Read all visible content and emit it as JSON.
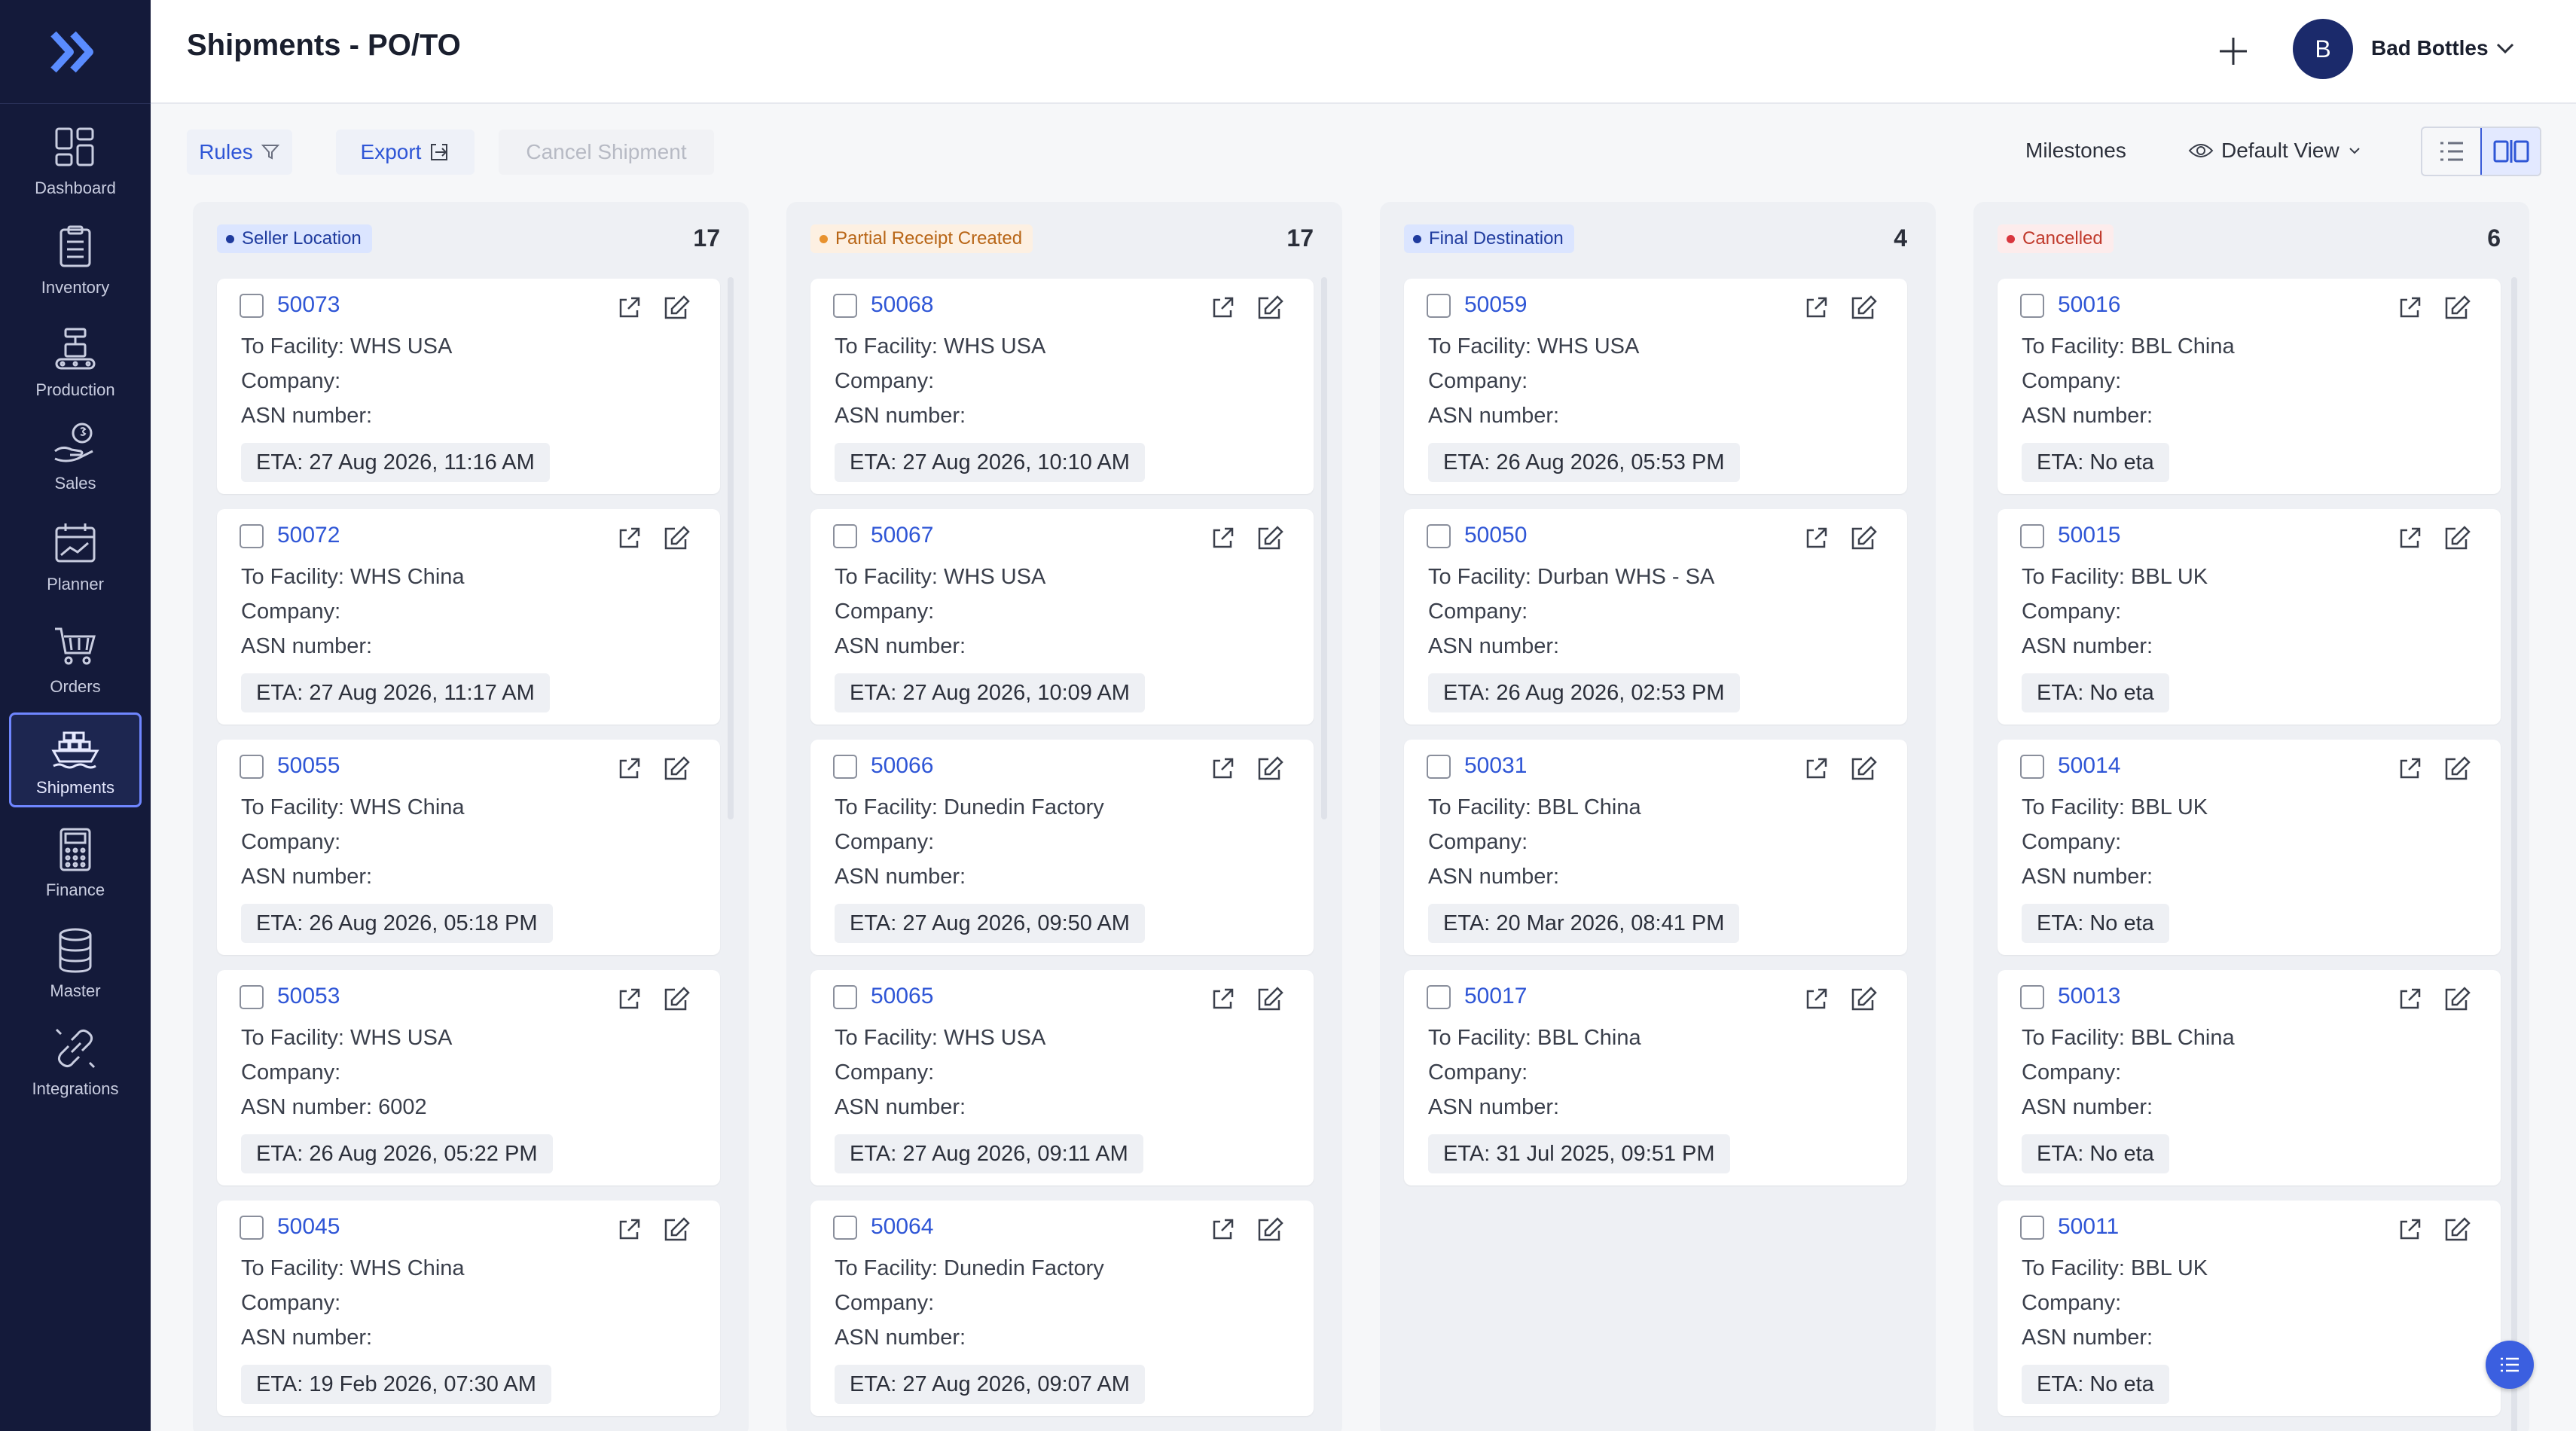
{
  "app": {
    "title": "Shipments - PO/TO",
    "company": "Bad Bottles",
    "avatar_letter": "B",
    "accent": "#2f56d6",
    "sidebar_bg": "#141a3a"
  },
  "sidebar": {
    "items": [
      {
        "label": "Dashboard",
        "icon": "dashboard-icon"
      },
      {
        "label": "Inventory",
        "icon": "clipboard-icon"
      },
      {
        "label": "Production",
        "icon": "conveyor-icon"
      },
      {
        "label": "Sales",
        "icon": "coin-hand-icon"
      },
      {
        "label": "Planner",
        "icon": "calendar-chart-icon"
      },
      {
        "label": "Orders",
        "icon": "cart-icon"
      },
      {
        "label": "Shipments",
        "icon": "ship-icon",
        "active": true
      },
      {
        "label": "Finance",
        "icon": "calculator-icon"
      },
      {
        "label": "Master",
        "icon": "database-icon"
      },
      {
        "label": "Integrations",
        "icon": "link-icon"
      }
    ]
  },
  "toolbar": {
    "rules_label": "Rules",
    "export_label": "Export",
    "cancel_label": "Cancel Shipment",
    "milestones_label": "Milestones",
    "view_label": "Default View"
  },
  "columns": [
    {
      "status": "Seller Location",
      "count": "17",
      "badge_bg": "#dbe5ff",
      "badge_fg": "#1f3b9e",
      "dot": "#1f3b9e",
      "cards": [
        {
          "id": "50073",
          "facility": "To Facility: WHS USA",
          "company": "Company:",
          "asn": "ASN number:",
          "eta": "ETA: 27 Aug 2026, 11:16 AM"
        },
        {
          "id": "50072",
          "facility": "To Facility: WHS China",
          "company": "Company:",
          "asn": "ASN number:",
          "eta": "ETA: 27 Aug 2026, 11:17 AM"
        },
        {
          "id": "50055",
          "facility": "To Facility: WHS China",
          "company": "Company:",
          "asn": "ASN number:",
          "eta": "ETA: 26 Aug 2026, 05:18 PM"
        },
        {
          "id": "50053",
          "facility": "To Facility: WHS USA",
          "company": "Company:",
          "asn": "ASN number: 6002",
          "eta": "ETA: 26 Aug 2026, 05:22 PM"
        },
        {
          "id": "50045",
          "facility": "To Facility: WHS China",
          "company": "Company:",
          "asn": "ASN number:",
          "eta": "ETA: 19 Feb 2026, 07:30 AM"
        }
      ]
    },
    {
      "status": "Partial Receipt Created",
      "count": "17",
      "badge_bg": "#fdf0e2",
      "badge_fg": "#b86516",
      "dot": "#e8922e",
      "cards": [
        {
          "id": "50068",
          "facility": "To Facility: WHS USA",
          "company": "Company:",
          "asn": "ASN number:",
          "eta": "ETA: 27 Aug 2026, 10:10 AM"
        },
        {
          "id": "50067",
          "facility": "To Facility: WHS USA",
          "company": "Company:",
          "asn": "ASN number:",
          "eta": "ETA: 27 Aug 2026, 10:09 AM"
        },
        {
          "id": "50066",
          "facility": "To Facility: Dunedin Factory",
          "company": "Company:",
          "asn": "ASN number:",
          "eta": "ETA: 27 Aug 2026, 09:50 AM"
        },
        {
          "id": "50065",
          "facility": "To Facility: WHS USA",
          "company": "Company:",
          "asn": "ASN number:",
          "eta": "ETA: 27 Aug 2026, 09:11 AM"
        },
        {
          "id": "50064",
          "facility": "To Facility: Dunedin Factory",
          "company": "Company:",
          "asn": "ASN number:",
          "eta": "ETA: 27 Aug 2026, 09:07 AM"
        }
      ]
    },
    {
      "status": "Final Destination",
      "count": "4",
      "badge_bg": "#dbe5ff",
      "badge_fg": "#1f3b9e",
      "dot": "#1f3b9e",
      "cards": [
        {
          "id": "50059",
          "facility": "To Facility: WHS USA",
          "company": "Company:",
          "asn": "ASN number:",
          "eta": "ETA: 26 Aug 2026, 05:53 PM"
        },
        {
          "id": "50050",
          "facility": "To Facility: Durban WHS - SA",
          "company": "Company:",
          "asn": "ASN number:",
          "eta": "ETA: 26 Aug 2026, 02:53 PM"
        },
        {
          "id": "50031",
          "facility": "To Facility: BBL China",
          "company": "Company:",
          "asn": "ASN number:",
          "eta": "ETA: 20 Mar 2026, 08:41 PM"
        },
        {
          "id": "50017",
          "facility": "To Facility: BBL China",
          "company": "Company:",
          "asn": "ASN number:",
          "eta": "ETA: 31 Jul 2025, 09:51 PM"
        }
      ]
    },
    {
      "status": "Cancelled",
      "count": "6",
      "badge_bg": "#fdecec",
      "badge_fg": "#c0392b",
      "dot": "#d9363e",
      "cards": [
        {
          "id": "50016",
          "facility": "To Facility: BBL China",
          "company": "Company:",
          "asn": "ASN number:",
          "eta": "ETA: No eta"
        },
        {
          "id": "50015",
          "facility": "To Facility: BBL UK",
          "company": "Company:",
          "asn": "ASN number:",
          "eta": "ETA: No eta"
        },
        {
          "id": "50014",
          "facility": "To Facility: BBL UK",
          "company": "Company:",
          "asn": "ASN number:",
          "eta": "ETA: No eta"
        },
        {
          "id": "50013",
          "facility": "To Facility: BBL China",
          "company": "Company:",
          "asn": "ASN number:",
          "eta": "ETA: No eta"
        },
        {
          "id": "50011",
          "facility": "To Facility: BBL UK",
          "company": "Company:",
          "asn": "ASN number:",
          "eta": "ETA: No eta"
        }
      ]
    }
  ]
}
